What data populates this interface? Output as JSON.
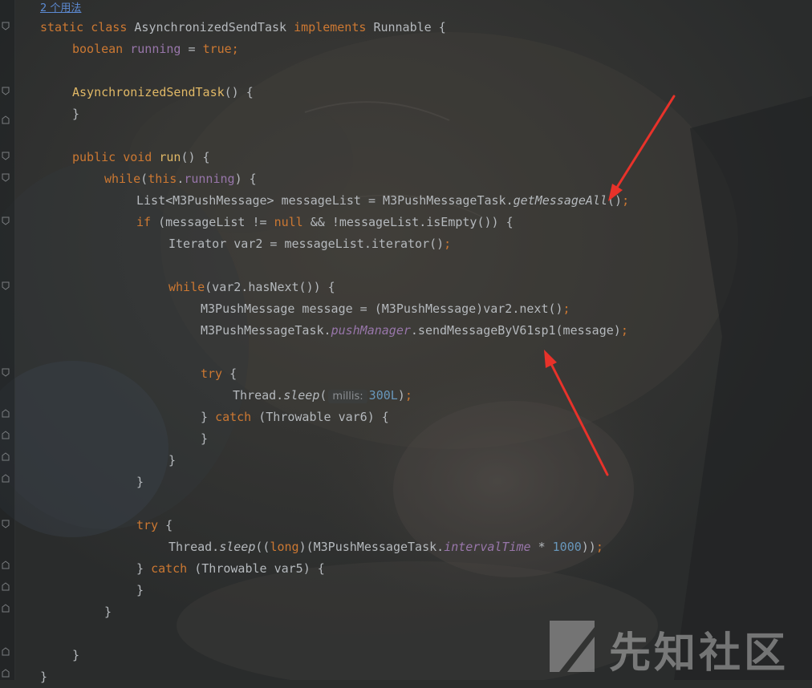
{
  "editor": {
    "usage_hint": "2 个用法",
    "lines": {
      "l01": {
        "kw1": "static class ",
        "name": "AsynchronizedSendTask ",
        "kw2": "implements ",
        "text": "Runnable {"
      },
      "l02": {
        "kw1": "boolean ",
        "field": "running",
        "text": " = ",
        "kw2": "true;"
      },
      "l04": {
        "ctor": "AsynchronizedSendTask",
        "text": "() {"
      },
      "l05": {
        "text": "}"
      },
      "l07": {
        "kw1": "public void ",
        "fn": "run",
        "text": "() {"
      },
      "l08": {
        "kw1": "while",
        "t1": "(",
        "kw2": "this",
        "t2": ".",
        "field": "running",
        "t3": ") {"
      },
      "l09": {
        "t1": "List<M3PushMessage> messageList = M3PushMessageTask.",
        "method": "getMessageAll",
        "t2": "()",
        "semi": ";"
      },
      "l10": {
        "kw1": "if",
        "t1": " (messageList != ",
        "kw2": "null",
        "t2": " && !messageList.isEmpty()) {"
      },
      "l11": {
        "t1": "Iterator var2 = messageList.iterator()",
        "semi": ";"
      },
      "l13": {
        "kw1": "while",
        "t1": "(var2.hasNext()) {"
      },
      "l14": {
        "t1": "M3PushMessage message = (M3PushMessage)var2.next()",
        "semi": ";"
      },
      "l15": {
        "t1": "M3PushMessageTask.",
        "field": "pushManager",
        "t2": ".sendMessageByV61sp1(message)",
        "semi": ";"
      },
      "l17": {
        "kw1": "try",
        "t1": " {"
      },
      "l18": {
        "t1": "Thread.",
        "method": "sleep",
        "t2": "(",
        "hint": "millis:",
        "num": "300L",
        "t3": ")",
        "semi": ";"
      },
      "l19": {
        "t1": "} ",
        "kw1": "catch",
        "t2": " (Throwable var6) {"
      },
      "l20": {
        "text": "}"
      },
      "l21": {
        "text": "}"
      },
      "l22": {
        "text": "}"
      },
      "l24": {
        "kw1": "try",
        "t1": " {"
      },
      "l25": {
        "t1": "Thread.",
        "method": "sleep",
        "t2": "((",
        "kw1": "long",
        "t3": ")(M3PushMessageTask.",
        "field": "intervalTime",
        "t4": " * ",
        "num": "1000",
        "t5": "))",
        "semi": ";"
      },
      "l26": {
        "t1": "} ",
        "kw1": "catch",
        "t2": " (Throwable var5) {"
      },
      "l27": {
        "text": "}"
      },
      "l28": {
        "text": "}"
      },
      "l30": {
        "text": "}"
      },
      "l31": {
        "text": "}"
      }
    }
  },
  "watermark": {
    "text": "先知社区",
    "logo_icon": "xianzhi-logo-icon"
  },
  "annotations": {
    "arrow_color": "#e8322a"
  },
  "colors": {
    "keyword": "#cc7832",
    "function_decl": "#e0b866",
    "field": "#9876aa",
    "number": "#6897bb",
    "text": "#b5b9bd",
    "link": "#5d8bd4"
  }
}
